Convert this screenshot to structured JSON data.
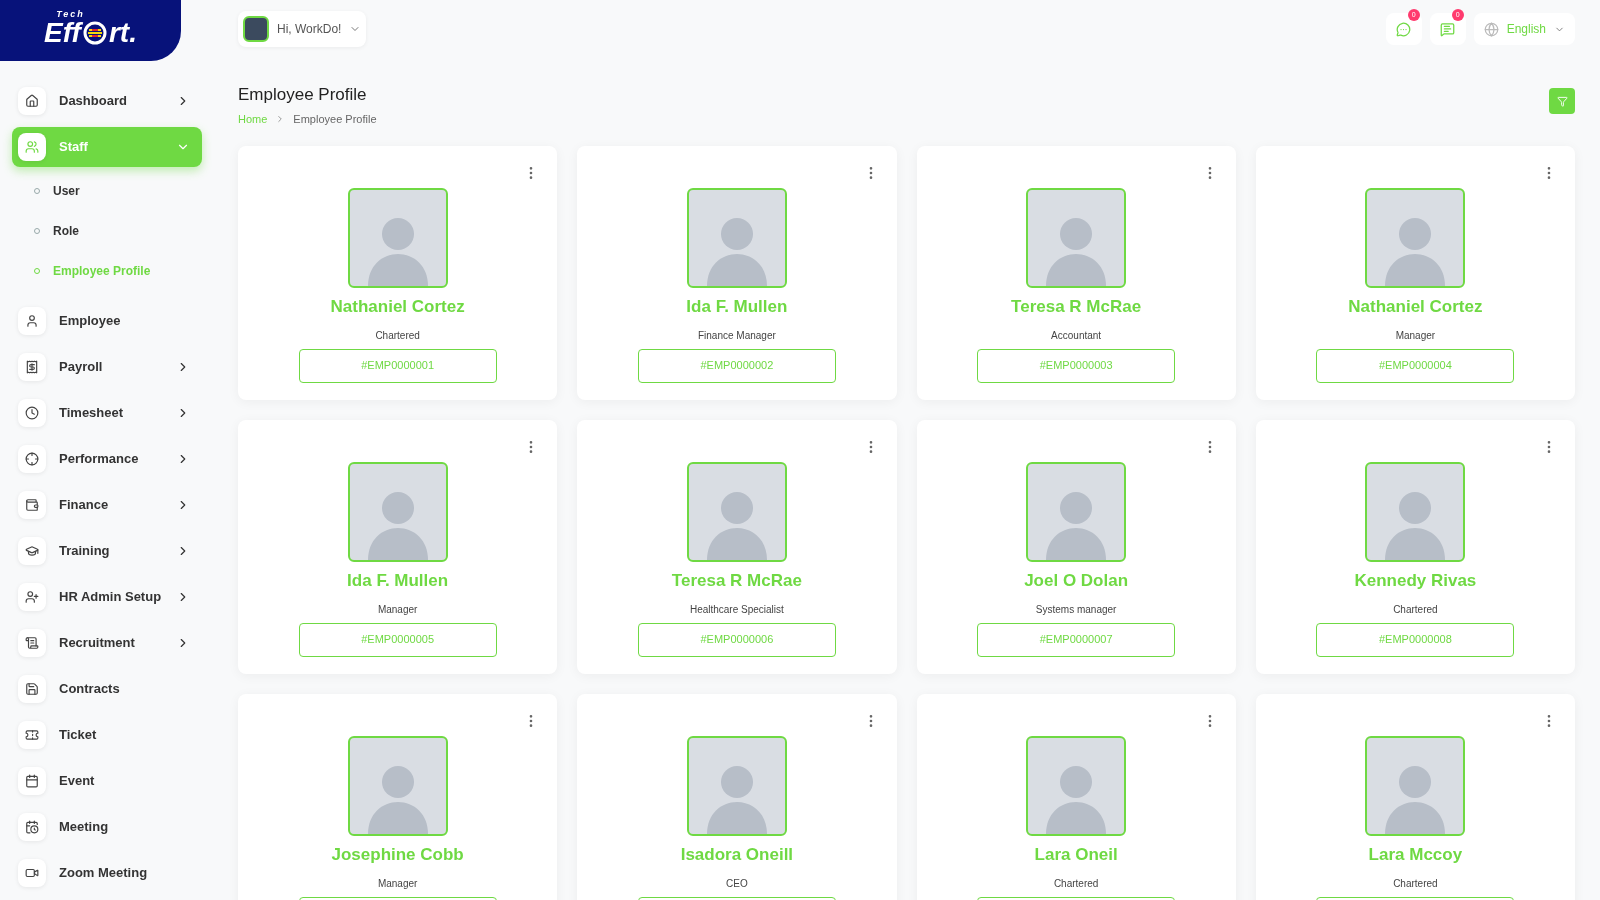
{
  "logo": {
    "small": "Tech",
    "left": "Eff",
    "right": "rt."
  },
  "user_menu": {
    "greeting": "Hi, WorkDo!"
  },
  "notifications": [
    {
      "kind": "chat",
      "count": "0"
    },
    {
      "kind": "message",
      "count": "0"
    }
  ],
  "language": {
    "label": "English"
  },
  "sidebar": {
    "items": [
      {
        "label": "Dashboard",
        "selected": false,
        "expanded": false
      },
      {
        "label": "Staff",
        "selected": true,
        "expanded": true,
        "children": [
          {
            "label": "User",
            "selected": false
          },
          {
            "label": "Role",
            "selected": false
          },
          {
            "label": "Employee Profile",
            "selected": true
          }
        ]
      },
      {
        "label": "Employee",
        "selected": false
      },
      {
        "label": "Payroll",
        "selected": false,
        "expanded": false
      },
      {
        "label": "Timesheet",
        "selected": false,
        "expanded": false
      },
      {
        "label": "Performance",
        "selected": false,
        "expanded": false
      },
      {
        "label": "Finance",
        "selected": false,
        "expanded": false
      },
      {
        "label": "Training",
        "selected": false,
        "expanded": false
      },
      {
        "label": "HR Admin Setup",
        "selected": false,
        "expanded": false
      },
      {
        "label": "Recruitment",
        "selected": false,
        "expanded": false
      },
      {
        "label": "Contracts",
        "selected": false
      },
      {
        "label": "Ticket",
        "selected": false
      },
      {
        "label": "Event",
        "selected": false
      },
      {
        "label": "Meeting",
        "selected": false
      },
      {
        "label": "Zoom Meeting",
        "selected": false
      }
    ]
  },
  "page": {
    "title": "Employee Profile",
    "breadcrumb": [
      "Home",
      "Employee Profile"
    ]
  },
  "employees": [
    {
      "name": "Nathaniel Cortez",
      "role": "Chartered",
      "id": "#EMP0000001"
    },
    {
      "name": "Ida F. Mullen",
      "role": "Finance Manager",
      "id": "#EMP0000002"
    },
    {
      "name": "Teresa R McRae",
      "role": "Accountant",
      "id": "#EMP0000003"
    },
    {
      "name": "Nathaniel Cortez",
      "role": "Manager",
      "id": "#EMP0000004"
    },
    {
      "name": "Ida F. Mullen",
      "role": "Manager",
      "id": "#EMP0000005"
    },
    {
      "name": "Teresa R McRae",
      "role": "Healthcare Specialist",
      "id": "#EMP0000006"
    },
    {
      "name": "Joel O Dolan",
      "role": "Systems manager",
      "id": "#EMP0000007"
    },
    {
      "name": "Kennedy Rivas",
      "role": "Chartered",
      "id": "#EMP0000008"
    },
    {
      "name": "Josephine Cobb",
      "role": "Manager"
    },
    {
      "name": "Isadora Oneill",
      "role": "CEO"
    },
    {
      "name": "Lara Oneil",
      "role": "Chartered"
    },
    {
      "name": "Lara Mccoy",
      "role": "Chartered"
    }
  ]
}
